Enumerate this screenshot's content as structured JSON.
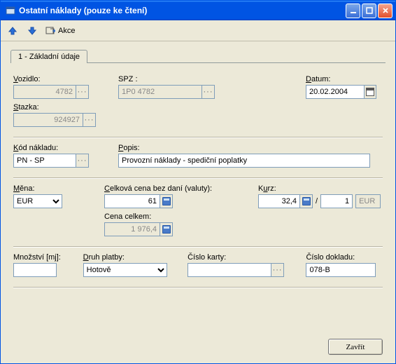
{
  "window": {
    "title": "Ostatní náklady (pouze ke čtení)"
  },
  "toolbar": {
    "action_label": "Akce"
  },
  "tabs": {
    "tab1": "1 - Základní údaje"
  },
  "labels": {
    "vozidlo": "Vozidlo:",
    "spz": "SPZ :",
    "datum": "Datum:",
    "stazka": "Stazka:",
    "kod_nakladu": "Kód nákladu:",
    "popis": "Popis:",
    "mena": "Měna:",
    "cena_bez_dani": "Celková cena bez daní (valuty):",
    "kurz": "Kurz:",
    "cena_celkem": "Cena celkem:",
    "mnozstvi": "Množství [mj]:",
    "druh_platby": "Druh platby:",
    "cislo_karty": "Číslo karty:",
    "cislo_dokladu": "Číslo dokladu:"
  },
  "values": {
    "vozidlo": "4782",
    "spz": "1P0 4782",
    "datum": "20.02.2004",
    "stazka": "924927",
    "kod_nakladu": "PN - SP",
    "popis": "Provozní náklady - spediční poplatky",
    "mena": "EUR",
    "cena_bez_dani": "61",
    "kurz_val": "32,4",
    "kurz_sep": "/",
    "kurz_per": "1",
    "kurz_cur": "EUR",
    "cena_celkem": "1 976,4",
    "mnozstvi": "",
    "druh_platby": "Hotově",
    "cislo_karty": "",
    "cislo_dokladu": "078-B"
  },
  "buttons": {
    "close": "Zavřít"
  }
}
